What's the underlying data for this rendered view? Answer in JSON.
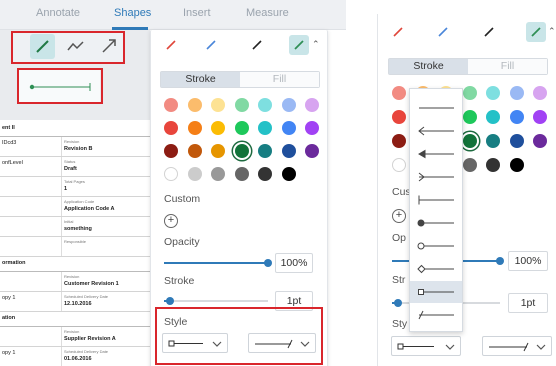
{
  "tabs": [
    {
      "label": "Annotate",
      "active": false
    },
    {
      "label": "Shapes",
      "active": true
    },
    {
      "label": "Insert",
      "active": false
    },
    {
      "label": "Measure",
      "active": false
    }
  ],
  "shape_tools": [
    {
      "icon": "line-tool-icon",
      "selected": true
    },
    {
      "icon": "polyline-tool-icon",
      "selected": false
    },
    {
      "icon": "arrow-tool-icon",
      "selected": false
    }
  ],
  "document": {
    "rows": [
      {
        "section": "ent II"
      },
      {
        "left": "IDcd3",
        "label": "Revision",
        "value": "Revision B"
      },
      {
        "left": "onfLevel",
        "label": "Status",
        "value": "Draft"
      },
      {
        "left": "",
        "label": "Total Pages",
        "value": "1"
      },
      {
        "left": "",
        "label": "Application Code",
        "value": "Application Code A"
      },
      {
        "left": "",
        "label": "Initial",
        "value": "something"
      },
      {
        "left": "",
        "label": "Responsible",
        "value": ""
      },
      {
        "section": "ormation"
      },
      {
        "left": "",
        "label": "Revision",
        "value": "Customer Revision 1"
      },
      {
        "left": "opy 1",
        "label": "Scheduled Delivery Date",
        "value": "12.10.2016"
      },
      {
        "section": "ation"
      },
      {
        "left": "",
        "label": "Revision",
        "value": "Supplier Revision A"
      },
      {
        "left": "opy 1",
        "label": "Scheduled Delivery Date",
        "value": "01.06.2016"
      }
    ]
  },
  "panel": {
    "tool_colors": [
      "#e0463a",
      "#4a86d9",
      "#222222",
      "#2f8f55"
    ],
    "stroke_tab": "Stroke",
    "fill_tab": "Fill",
    "palette": [
      [
        "#f28b82",
        "#fbbc6c",
        "#fde293",
        "#81d9a3",
        "#7edfe0",
        "#9ab9f4",
        "#d7a4f0"
      ],
      [
        "#e8453c",
        "#f57f17",
        "#fbbc04",
        "#1ec85b",
        "#24c1c7",
        "#4285f4",
        "#a142f4"
      ],
      [
        "#8c1c13",
        "#c1580b",
        "#e69500",
        "#12733a",
        "#177e82",
        "#1f4f9c",
        "#6b2a9c"
      ],
      [
        "#ffffff",
        "#cccccc",
        "#999999",
        "#666666",
        "#333333",
        "#000000"
      ]
    ],
    "selected_color": "#12733a",
    "custom_label": "Custom",
    "add_custom": "+",
    "opacity_label": "Opacity",
    "opacity_value": "100%",
    "opacity_fraction": 1.0,
    "stroke_label": "Stroke",
    "stroke_value": "1pt",
    "stroke_fraction": 0.06,
    "style_label": "Style",
    "style_short_label": "Sty",
    "custom_short_label": "Cus",
    "opacity_short_label": "Op",
    "stroke_short_label": "Str"
  },
  "line_end_options": [
    {
      "name": "line-end-none-option",
      "selected": false
    },
    {
      "name": "line-end-open-arrow-option",
      "selected": false
    },
    {
      "name": "line-end-closed-arrow-option",
      "selected": false
    },
    {
      "name": "line-end-reverse-arrow-option",
      "selected": false
    },
    {
      "name": "line-end-butt-option",
      "selected": false
    },
    {
      "name": "line-end-circle-filled-option",
      "selected": false
    },
    {
      "name": "line-end-circle-option",
      "selected": false
    },
    {
      "name": "line-end-diamond-option",
      "selected": false
    },
    {
      "name": "line-end-square-option",
      "selected": true
    },
    {
      "name": "line-end-slash-option",
      "selected": false
    }
  ]
}
